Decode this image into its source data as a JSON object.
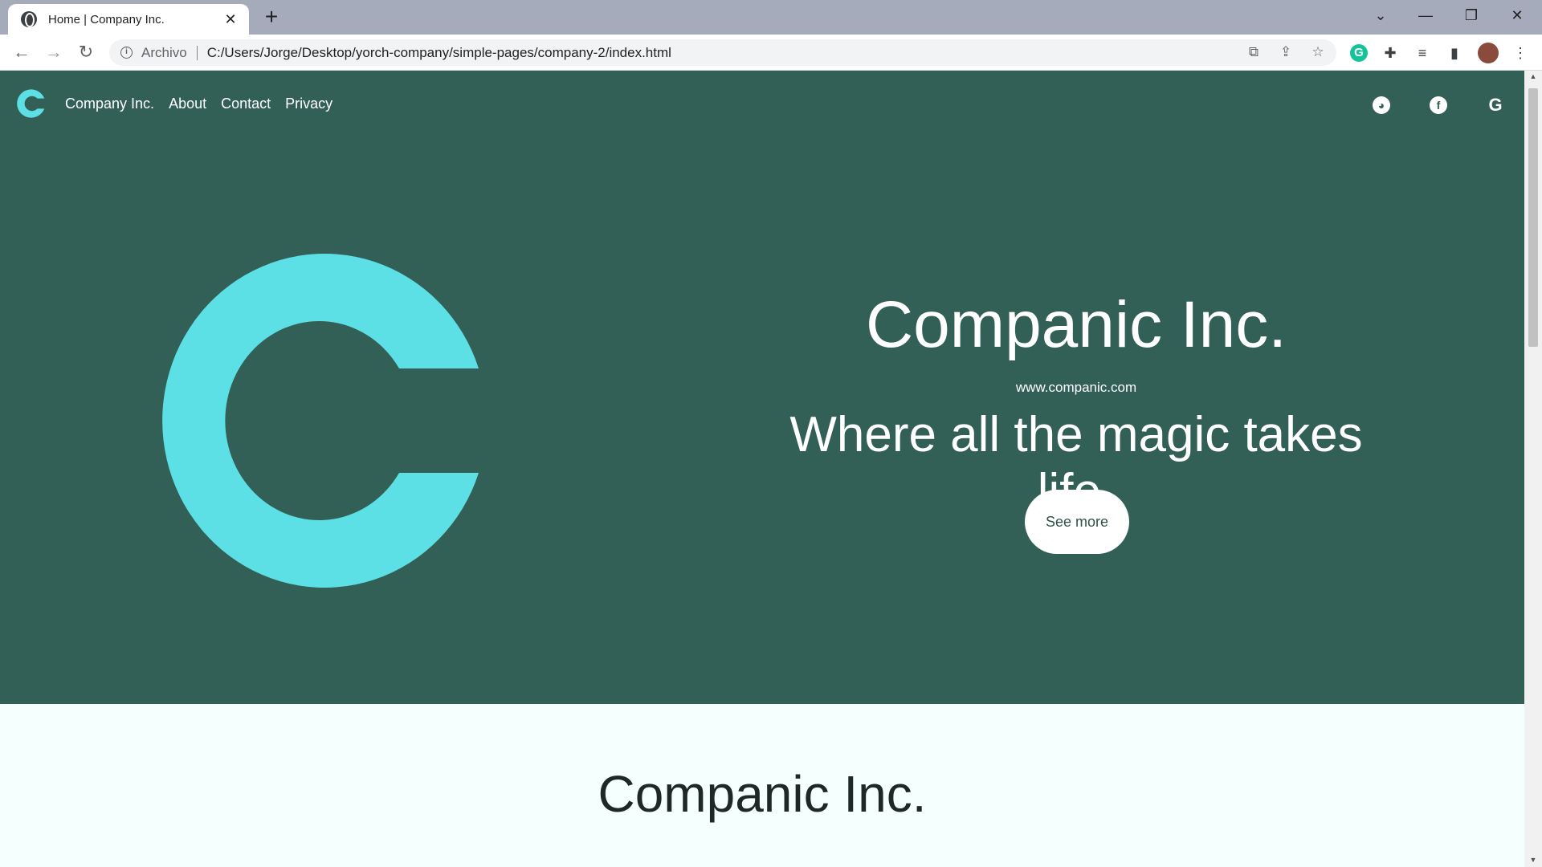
{
  "browser": {
    "tab_title": "Home | Company Inc.",
    "new_tab": "+",
    "scheme_label": "Archivo",
    "url": "C:/Users/Jorge/Desktop/yorch-company/simple-pages/company-2/index.html"
  },
  "nav": {
    "brand": "Company Inc.",
    "links": [
      "About",
      "Contact",
      "Privacy"
    ],
    "social": [
      "github-icon",
      "facebook-icon",
      "google-icon"
    ]
  },
  "hero": {
    "title": "Companic Inc.",
    "url": "www.companic.com",
    "tagline": "Where all the magic takes life.",
    "cta": "See more"
  },
  "section2": {
    "title": "Companic Inc."
  },
  "colors": {
    "hero_bg": "#336056",
    "logo": "#5ce0e5",
    "page_bg": "#f5fffd"
  }
}
